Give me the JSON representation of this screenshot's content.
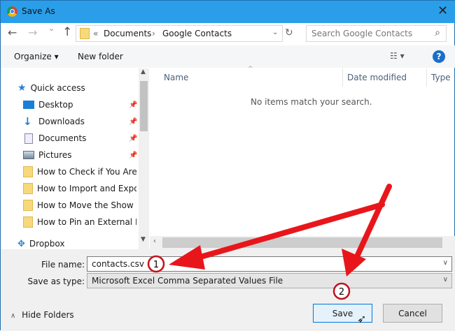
{
  "window": {
    "title": "Save As",
    "close": "✕"
  },
  "nav": {
    "back": "←",
    "forward": "→",
    "recent": "⌄",
    "up": "↑",
    "breadcrumb_prefix": "«",
    "path": [
      "Documents",
      "Google Contacts"
    ],
    "sep": "›",
    "refresh": "↻",
    "search_placeholder": "Search Google Contacts",
    "search_icon": "⌕"
  },
  "toolbar": {
    "organize": "Organize ▾",
    "new_folder": "New folder",
    "view": "☷ ▾",
    "help": "?"
  },
  "sidebar": {
    "quick_access": "Quick access",
    "items": [
      {
        "label": "Desktop",
        "pinned": true
      },
      {
        "label": "Downloads",
        "pinned": true
      },
      {
        "label": "Documents",
        "pinned": true
      },
      {
        "label": "Pictures",
        "pinned": true
      },
      {
        "label": "How to Check if You Are Ru"
      },
      {
        "label": "How to Import and Export G"
      },
      {
        "label": "How to Move the Show De"
      },
      {
        "label": "How to Pin an External Driv"
      }
    ],
    "dropbox": "Dropbox"
  },
  "columns": [
    "Name",
    "Date modified",
    "Type"
  ],
  "empty_message": "No items match your search.",
  "form": {
    "file_name_label": "File name:",
    "file_name": "contacts.csv",
    "type_label": "Save as type:",
    "type_value": "Microsoft Excel Comma Separated Values File"
  },
  "footer": {
    "hide_folders": "Hide Folders",
    "save": "Save",
    "cancel": "Cancel"
  },
  "callouts": [
    "1",
    "2"
  ]
}
